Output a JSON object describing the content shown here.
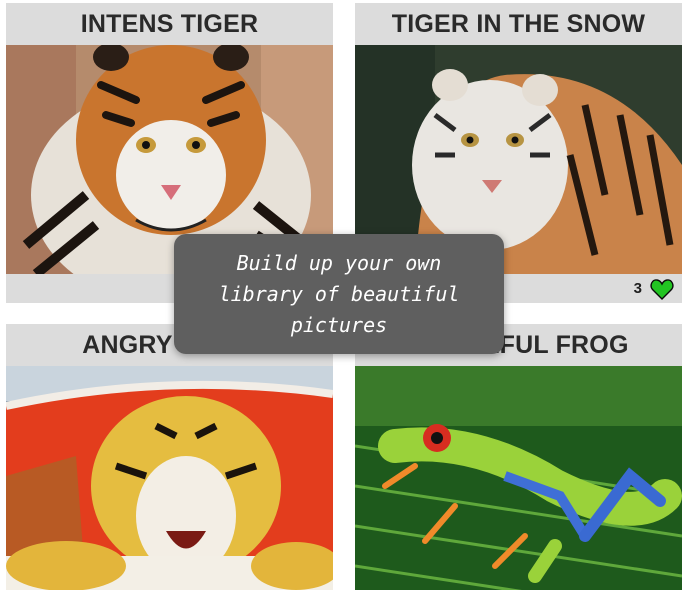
{
  "cards": [
    {
      "title": "INTENS TIGER",
      "photo": "tiger-portrait",
      "likes": ""
    },
    {
      "title": "TIGER IN THE SNOW",
      "photo": "snow-tiger",
      "likes": "3"
    },
    {
      "title": "ANGRY TIGER",
      "photo": "tiger-on-boat"
    },
    {
      "title": "COLORFUL FROG",
      "photo": "tree-frog-on-leaf"
    }
  ],
  "tooltip": {
    "text": "Build up your own library of beautiful pictures"
  },
  "colors": {
    "card_bg": "#dcdcdc",
    "tooltip_bg": "#5f5f5f",
    "heart": "#22c422"
  },
  "icons": {
    "like": "heart-icon"
  }
}
